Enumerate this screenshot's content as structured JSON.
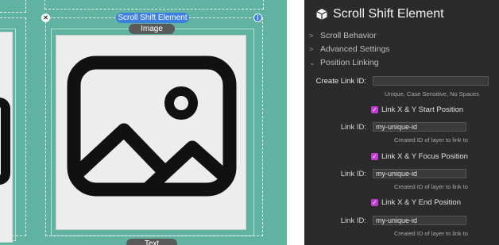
{
  "canvas": {
    "element_tag": "Scroll Shift Element",
    "image_tag": "Image",
    "text_tag": "Text",
    "background_color": "#5fb3a0",
    "accent_color": "#3d7fe0"
  },
  "panel": {
    "title": "Scroll Shift Element",
    "title_icon": "cube-icon",
    "sections": [
      {
        "label": "Scroll Behavior",
        "expanded": false
      },
      {
        "label": "Advanced Settings",
        "expanded": false
      },
      {
        "label": "Position Linking",
        "expanded": true
      }
    ],
    "create_link": {
      "label": "Create Link ID:",
      "value": "",
      "hint": "Unique, Case Sensitive, No Spaces"
    },
    "links": [
      {
        "checkbox_label": "Link X & Y Start Position",
        "checked": true,
        "field_label": "Link ID:",
        "value": "my-unique-id",
        "hint": "Created ID of layer to link to"
      },
      {
        "checkbox_label": "Link X & Y Focus Position",
        "checked": true,
        "field_label": "Link ID:",
        "value": "my-unique-id",
        "hint": "Created ID of layer to link to"
      },
      {
        "checkbox_label": "Link X & Y End Position",
        "checked": true,
        "field_label": "Link ID:",
        "value": "my-unique-id",
        "hint": "Created ID of layer to link to"
      }
    ],
    "checkbox_color": "#c23bd4"
  }
}
